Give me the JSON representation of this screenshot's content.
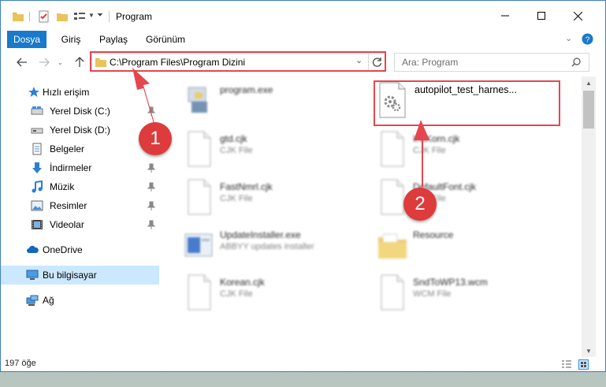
{
  "window": {
    "title": "Program",
    "controls": {
      "minimize": "minimize-icon",
      "maximize": "maximize-icon",
      "close": "close-icon"
    }
  },
  "ribbon": {
    "tabs": [
      {
        "label": "Dosya",
        "active": true
      },
      {
        "label": "Giriş"
      },
      {
        "label": "Paylaş"
      },
      {
        "label": "Görünüm"
      }
    ]
  },
  "nav": {
    "address": "C:\\Program Files\\Program Dizini",
    "search_placeholder": "Ara: Program"
  },
  "sidebar": {
    "items": [
      {
        "label": "Hızlı erişim",
        "icon": "star-icon",
        "level": "top"
      },
      {
        "label": "Yerel Disk (C:)",
        "icon": "drive-icon",
        "pinned": true
      },
      {
        "label": "Yerel Disk (D:)",
        "icon": "drive-icon",
        "pinned": true
      },
      {
        "label": "Belgeler",
        "icon": "documents-icon",
        "pinned": true
      },
      {
        "label": "İndirmeler",
        "icon": "download-icon",
        "pinned": true
      },
      {
        "label": "Müzik",
        "icon": "music-icon",
        "pinned": true
      },
      {
        "label": "Resimler",
        "icon": "pictures-icon",
        "pinned": true
      },
      {
        "label": "Videolar",
        "icon": "video-icon",
        "pinned": true
      },
      {
        "label": "OneDrive",
        "icon": "cloud-icon",
        "level": "root"
      },
      {
        "label": "Bu bilgisayar",
        "icon": "computer-icon",
        "level": "root",
        "selected": true
      },
      {
        "label": "Ağ",
        "icon": "network-icon",
        "level": "root"
      }
    ]
  },
  "files": [
    {
      "name": "program.exe",
      "type": "",
      "icon": "exe-icon"
    },
    {
      "name": "autopilot_test_harnes...",
      "type": "",
      "icon": "gear-file-icon",
      "highlighted": true
    },
    {
      "name": "gtd.cjk",
      "type": "CJK File",
      "icon": "file-icon"
    },
    {
      "name": "IntlKorn.cjk",
      "type": "CJK File",
      "icon": "file-icon"
    },
    {
      "name": "FastNmrl.cjk",
      "type": "CJK File",
      "icon": "file-icon"
    },
    {
      "name": "DefaultFont.cjk",
      "type": "CJK File",
      "icon": "file-icon"
    },
    {
      "name": "UpdateInstaller.exe",
      "type": "ABBYY updates installer",
      "icon": "installer-icon"
    },
    {
      "name": "Resource",
      "type": "",
      "icon": "folder-icon"
    },
    {
      "name": "Korean.cjk",
      "type": "CJK File",
      "icon": "file-icon"
    },
    {
      "name": "SndToWP13.wcm",
      "type": "WCM File",
      "icon": "file-icon"
    }
  ],
  "status": {
    "item_count": "197 öğe"
  },
  "annotations": {
    "step1": "1",
    "step2": "2",
    "color": "#e4474f"
  }
}
